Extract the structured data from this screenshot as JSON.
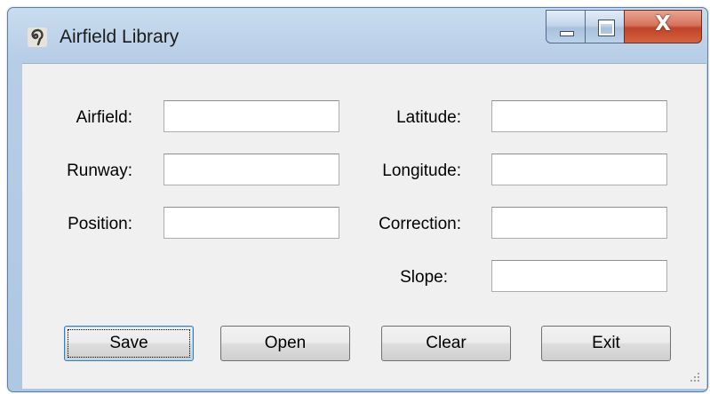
{
  "window": {
    "title": "Airfield Library"
  },
  "form": {
    "left": [
      {
        "label": "Airfield:",
        "value": ""
      },
      {
        "label": "Runway:",
        "value": ""
      },
      {
        "label": "Position:",
        "value": ""
      }
    ],
    "right": [
      {
        "label": "Latitude:",
        "value": ""
      },
      {
        "label": "Longitude:",
        "value": ""
      },
      {
        "label": "Correction:",
        "value": ""
      },
      {
        "label": "Slope:",
        "value": ""
      }
    ]
  },
  "buttons": {
    "save": "Save",
    "open": "Open",
    "clear": "Clear",
    "exit": "Exit"
  },
  "caption": {
    "close_glyph": "X"
  },
  "colors": {
    "close_button": "#c7432b",
    "window_frame": "#b7cde6",
    "client_bg": "#f0f0f0",
    "default_button_border": "#3c7fb1"
  }
}
